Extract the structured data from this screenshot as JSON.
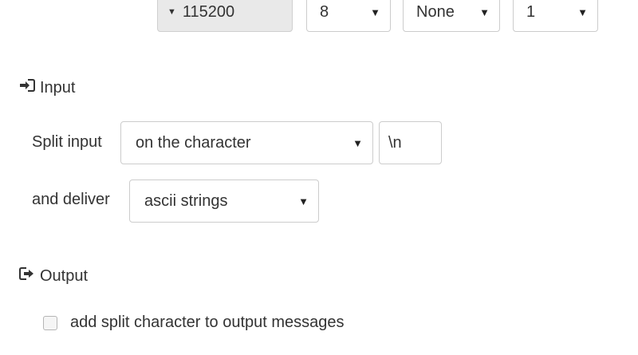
{
  "serial": {
    "baud_rate": "115200",
    "data_bits": "8",
    "parity": "None",
    "stop_bits": "1"
  },
  "input_section": {
    "title": "Input",
    "icon": "sign-in-icon",
    "split_label": "Split input",
    "split_mode": "on the character",
    "split_char": "\\n",
    "deliver_label": "and deliver",
    "deliver_mode": "ascii strings"
  },
  "output_section": {
    "title": "Output",
    "icon": "sign-out-icon",
    "add_char_label": "add split character to output messages",
    "add_char_checked": false
  }
}
